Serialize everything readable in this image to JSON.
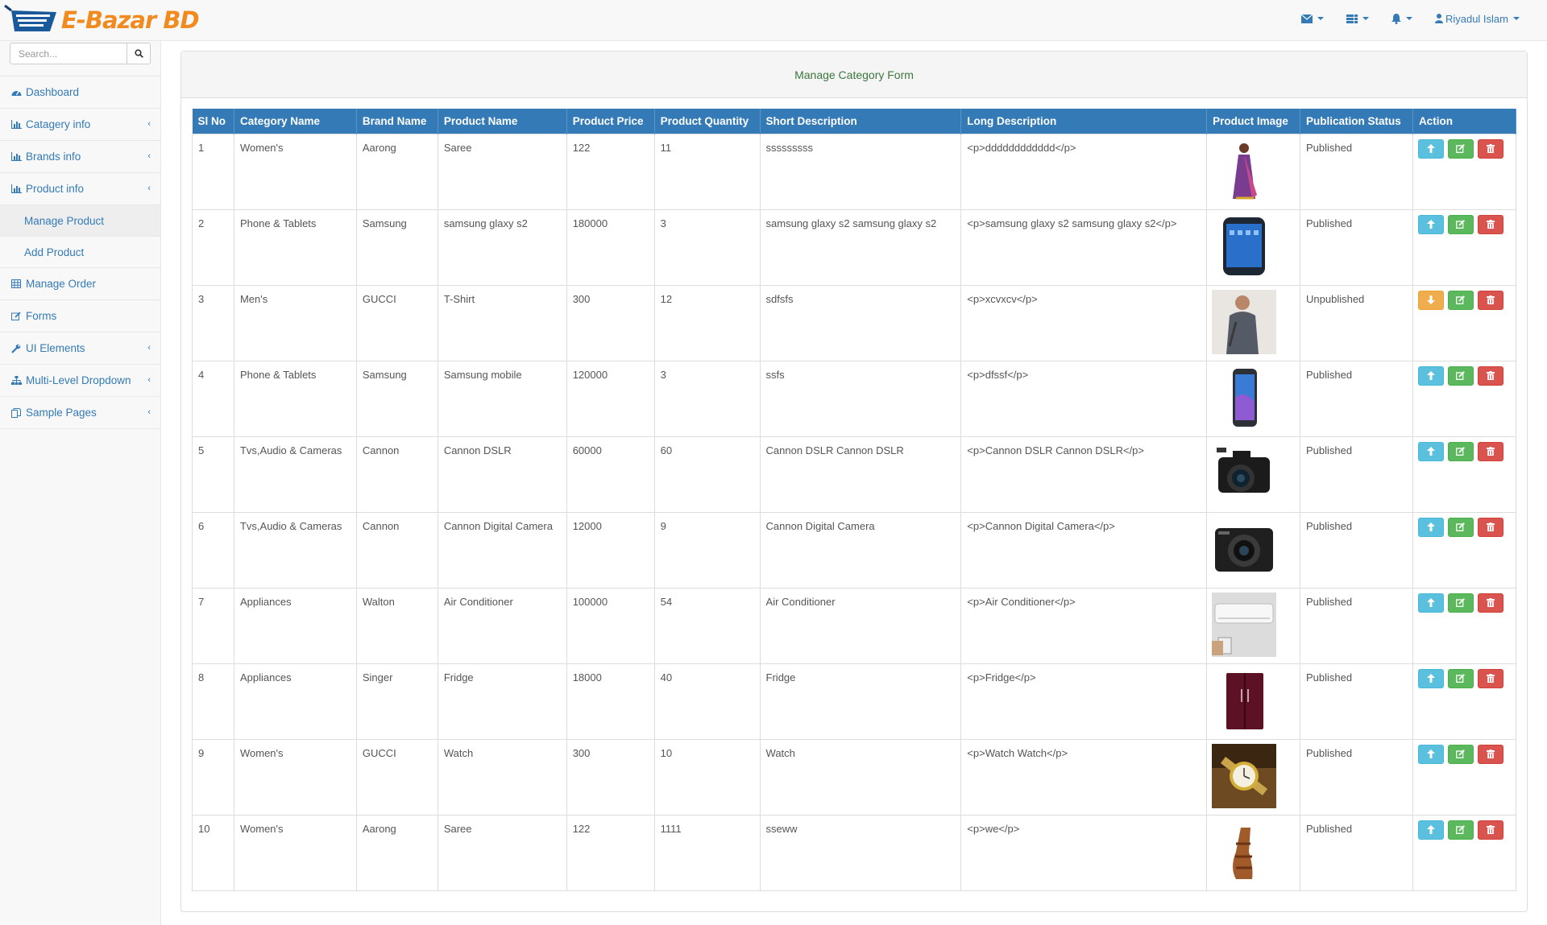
{
  "brand": {
    "name": "E-Bazar BD"
  },
  "topbar": {
    "user_name": "Riyadul Islam"
  },
  "sidebar": {
    "search_placeholder": "Search...",
    "items": [
      {
        "label": "Dashboard",
        "icon": "dashboard-icon"
      },
      {
        "label": "Catagery info",
        "icon": "bar-chart-icon"
      },
      {
        "label": "Brands info",
        "icon": "bar-chart-icon"
      },
      {
        "label": "Product info",
        "icon": "bar-chart-icon"
      },
      {
        "label": "Manage Product"
      },
      {
        "label": "Add Product"
      },
      {
        "label": "Manage Order",
        "icon": "table-icon"
      },
      {
        "label": "Forms",
        "icon": "edit-icon"
      },
      {
        "label": "UI Elements",
        "icon": "wrench-icon"
      },
      {
        "label": "Multi-Level Dropdown",
        "icon": "sitemap-icon"
      },
      {
        "label": "Sample Pages",
        "icon": "files-icon"
      }
    ]
  },
  "panel": {
    "title": "Manage Category Form"
  },
  "table": {
    "headers": [
      "Sl No",
      "Category Name",
      "Brand Name",
      "Product Name",
      "Product Price",
      "Product Quantity",
      "Short Description",
      "Long Description",
      "Product Image",
      "Publication Status",
      "Action"
    ],
    "rows": [
      {
        "sl": "1",
        "category": "Women's",
        "brand": "Aarong",
        "product": "Saree",
        "price": "122",
        "qty": "11",
        "short": "sssssssss",
        "long": "<p>dddddddddddd</p>",
        "image": "saree",
        "status": "Published",
        "published": true
      },
      {
        "sl": "2",
        "category": "Phone & Tablets",
        "brand": "Samsung",
        "product": "samsung glaxy s2",
        "price": "180000",
        "qty": "3",
        "short": "samsung glaxy s2 samsung glaxy s2",
        "long": "<p>samsung glaxy s2 samsung glaxy s2</p>",
        "image": "phone",
        "status": "Published",
        "published": true
      },
      {
        "sl": "3",
        "category": "Men's",
        "brand": "GUCCI",
        "product": "T-Shirt",
        "price": "300",
        "qty": "12",
        "short": "sdfsfs",
        "long": "<p>xcvxcv</p>",
        "image": "man",
        "status": "Unpublished",
        "published": false
      },
      {
        "sl": "4",
        "category": "Phone & Tablets",
        "brand": "Samsung",
        "product": "Samsung mobile",
        "price": "120000",
        "qty": "3",
        "short": "ssfs",
        "long": "<p>dfssf</p>",
        "image": "mobile",
        "status": "Published",
        "published": true
      },
      {
        "sl": "5",
        "category": "Tvs,Audio & Cameras",
        "brand": "Cannon",
        "product": "Cannon DSLR",
        "price": "60000",
        "qty": "60",
        "short": "Cannon DSLR Cannon DSLR",
        "long": "<p>Cannon DSLR Cannon DSLR</p>",
        "image": "dslr",
        "status": "Published",
        "published": true
      },
      {
        "sl": "6",
        "category": "Tvs,Audio & Cameras",
        "brand": "Cannon",
        "product": "Cannon Digital Camera",
        "price": "12000",
        "qty": "9",
        "short": "Cannon Digital Camera",
        "long": "<p>Cannon Digital Camera</p>",
        "image": "camera",
        "status": "Published",
        "published": true
      },
      {
        "sl": "7",
        "category": "Appliances",
        "brand": "Walton",
        "product": "Air Conditioner",
        "price": "100000",
        "qty": "54",
        "short": "Air Conditioner",
        "long": "<p>Air Conditioner</p>",
        "image": "ac",
        "status": "Published",
        "published": true
      },
      {
        "sl": "8",
        "category": "Appliances",
        "brand": "Singer",
        "product": "Fridge",
        "price": "18000",
        "qty": "40",
        "short": "Fridge",
        "long": "<p>Fridge</p>",
        "image": "fridge",
        "status": "Published",
        "published": true
      },
      {
        "sl": "9",
        "category": "Women's",
        "brand": "GUCCI",
        "product": "Watch",
        "price": "300",
        "qty": "10",
        "short": "Watch",
        "long": "<p>Watch Watch</p>",
        "image": "watch",
        "status": "Published",
        "published": true
      },
      {
        "sl": "10",
        "category": "Women's",
        "brand": "Aarong",
        "product": "Saree",
        "price": "122",
        "qty": "1111",
        "short": "sseww",
        "long": "<p>we</p>",
        "image": "sandal",
        "status": "Published",
        "published": true
      }
    ]
  },
  "colors": {
    "primary": "#337ab7",
    "info": "#5bc0de",
    "warning": "#f0ad4e",
    "success": "#5cb85c",
    "danger": "#d9534f",
    "brand_orange": "#f18a1f"
  }
}
